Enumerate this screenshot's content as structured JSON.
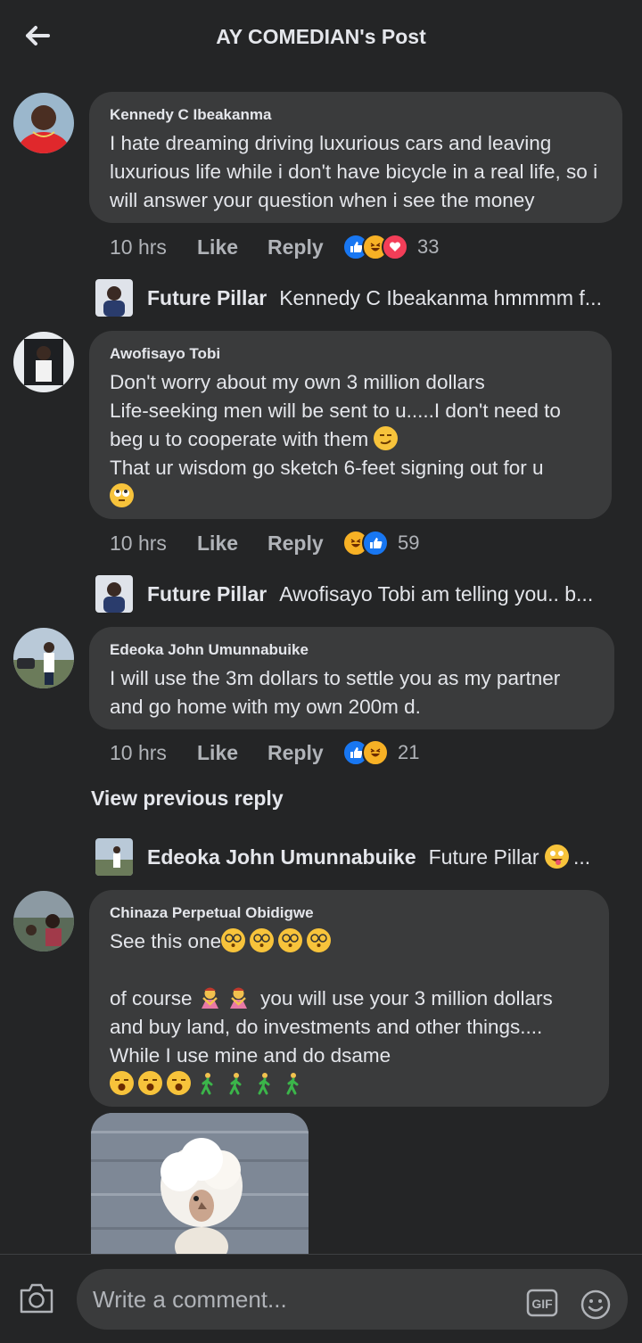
{
  "header": {
    "title": "AY COMEDIAN's Post",
    "back_icon": "arrow-left-icon"
  },
  "comments": [
    {
      "author": "Kennedy C Ibeakanma",
      "text": "I hate dreaming driving luxurious cars and leaving luxurious life while i don't have bicycle in a real life, so i will answer your question when i see the money",
      "time": "10 hrs",
      "like_label": "Like",
      "reply_label": "Reply",
      "reactions": [
        "like",
        "haha",
        "love"
      ],
      "reaction_count": "33",
      "reply": {
        "author": "Future Pillar",
        "text": "Kennedy C Ibeakanma hmmmm f..."
      }
    },
    {
      "author": "Awofisayo Tobi",
      "text_lines": [
        "Don't worry about my own 3 million dollars",
        "Life-seeking men will be sent to u.....I don't need to beg u to cooperate with them",
        "That ur wisdom go sketch 6-feet signing out for u"
      ],
      "time": "10 hrs",
      "like_label": "Like",
      "reply_label": "Reply",
      "reactions": [
        "haha",
        "like"
      ],
      "reaction_count": "59",
      "reply": {
        "author": "Future Pillar",
        "text": "Awofisayo Tobi am telling you.. b..."
      }
    },
    {
      "author": "Edeoka John Umunnabuike",
      "text": "I will use the 3m dollars to settle you as my partner and go home with my own 200m d.",
      "time": "10 hrs",
      "like_label": "Like",
      "reply_label": "Reply",
      "reactions": [
        "like",
        "haha"
      ],
      "reaction_count": "21",
      "view_previous": "View previous reply",
      "reply": {
        "author": "Edeoka John Umunnabuike",
        "text": "Future Pillar",
        "suffix": "..."
      }
    },
    {
      "author": "Chinaza Perpetual Obidigwe",
      "line1": "See this one",
      "line2_pre": "of course",
      "line2_post": "you will use your 3 million dollars and buy land, do investments and other things....",
      "line3": "While I use mine and do dsame"
    }
  ],
  "composer": {
    "placeholder": "Write a comment...",
    "camera_icon": "camera-icon",
    "gif_label": "GIF",
    "smiley_icon": "smiley-icon"
  }
}
